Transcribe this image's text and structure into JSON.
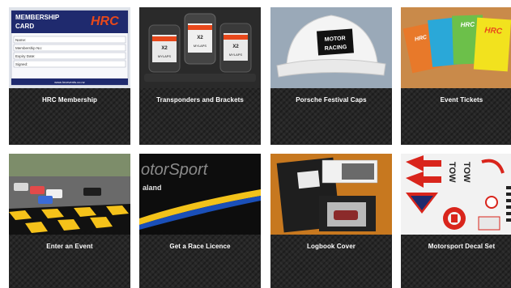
{
  "products": [
    {
      "label": "HRC Membership",
      "image": {
        "kind": "membership-card",
        "card_title": "MEMBERSHIP CARD",
        "brand": "HRC",
        "fields": [
          "Name:",
          "Membership No:",
          "Expiry Date:",
          "Signed:"
        ],
        "website": "www.hrcevents.co.nz"
      }
    },
    {
      "label": "Transponders and Brackets",
      "image": {
        "kind": "transponders",
        "device_label": "MYLAPS"
      }
    },
    {
      "label": "Porsche Festival Caps",
      "image": {
        "kind": "cap",
        "cap_text": [
          "MOTOR",
          "RACING"
        ]
      }
    },
    {
      "label": "Event Tickets",
      "image": {
        "kind": "tickets",
        "brand": "HRC"
      }
    },
    {
      "label": "Enter an Event",
      "image": {
        "kind": "race-photo"
      }
    },
    {
      "label": "Get a Race Licence",
      "image": {
        "kind": "licence-banner",
        "banner_text": "otorSport",
        "sub_text": "aland"
      }
    },
    {
      "label": "Logbook Cover",
      "image": {
        "kind": "logbook"
      }
    },
    {
      "label": "Motorsport Decal Set",
      "image": {
        "kind": "decals",
        "decal_text": "TOW"
      }
    }
  ],
  "colors": {
    "card_bg": "#262626",
    "label": "#ffffff",
    "page_bg": "#ffffff",
    "hrc_red": "#e8481b",
    "navy": "#1f2a6e"
  }
}
